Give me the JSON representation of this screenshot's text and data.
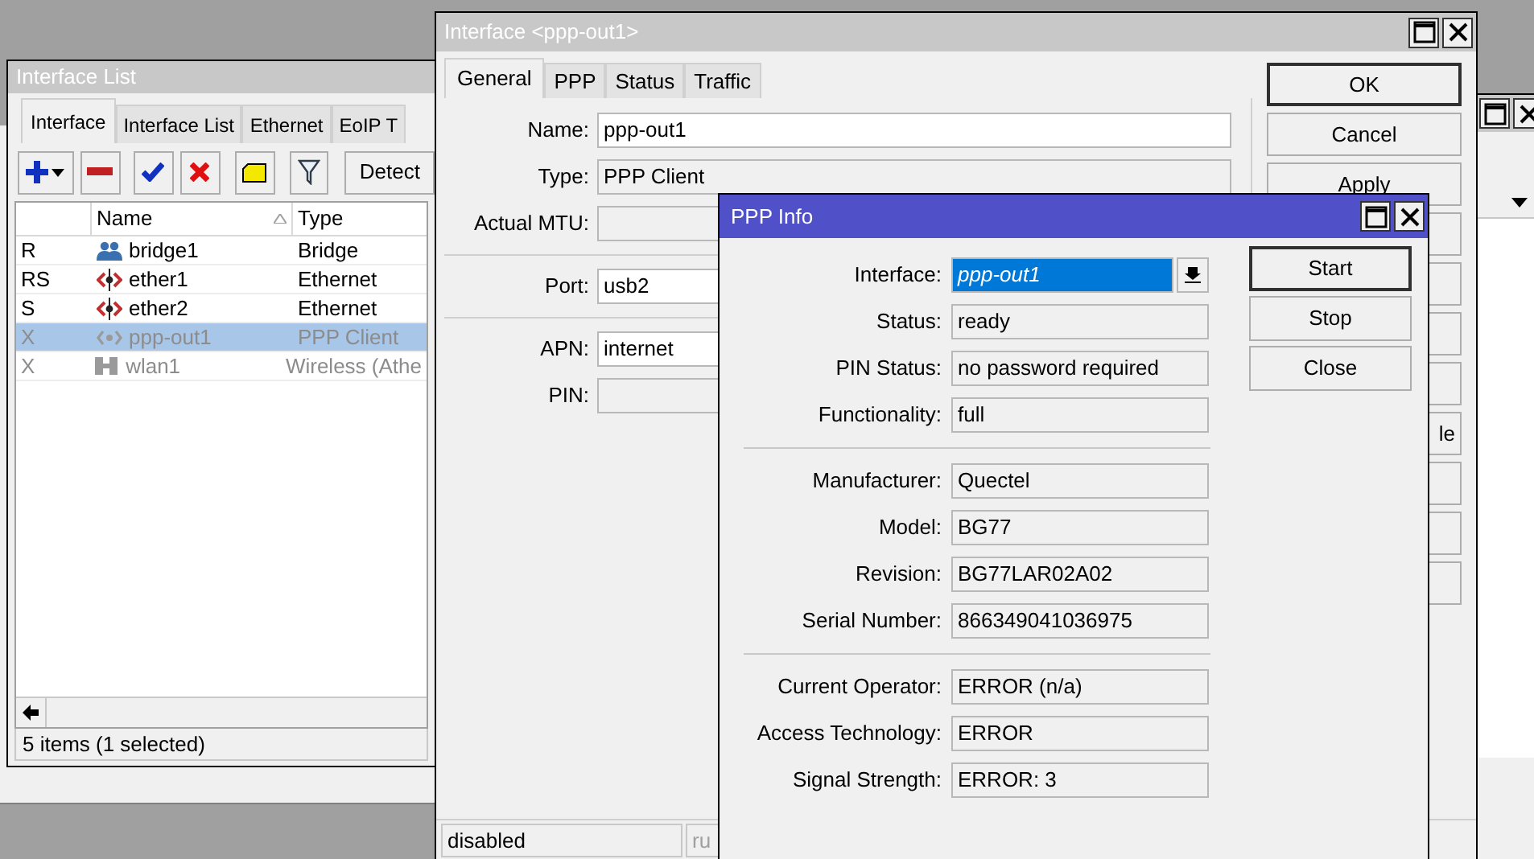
{
  "interface_list": {
    "title": "Interface List",
    "tabs": [
      {
        "label": "Interface",
        "selected": true
      },
      {
        "label": "Interface List",
        "selected": false
      },
      {
        "label": "Ethernet",
        "selected": false
      },
      {
        "label": "EoIP T",
        "selected": false
      }
    ],
    "detect_button": "Detect",
    "columns": [
      "Name",
      "Type"
    ],
    "rows": [
      {
        "flags": "R",
        "name": "bridge1",
        "type": "Bridge",
        "kind": "bridge",
        "disabled": false,
        "selected": false
      },
      {
        "flags": "RS",
        "name": "ether1",
        "type": "Ethernet",
        "kind": "ethernet",
        "disabled": false,
        "selected": false
      },
      {
        "flags": "S",
        "name": "ether2",
        "type": "Ethernet",
        "kind": "ethernet",
        "disabled": false,
        "selected": false
      },
      {
        "flags": "X",
        "name": "ppp-out1",
        "type": "PPP Client",
        "kind": "ppp",
        "disabled": true,
        "selected": true
      },
      {
        "flags": "X",
        "name": "wlan1",
        "type": "Wireless (Athe",
        "kind": "wireless",
        "disabled": true,
        "selected": false
      }
    ],
    "status": "5 items (1 selected)"
  },
  "interface_window": {
    "title": "Interface <ppp-out1>",
    "tabs": [
      {
        "label": "General",
        "selected": true
      },
      {
        "label": "PPP",
        "selected": false
      },
      {
        "label": "Status",
        "selected": false
      },
      {
        "label": "Traffic",
        "selected": false
      }
    ],
    "sections": [
      [
        {
          "label": "Name:",
          "value": "ppp-out1",
          "editable": true
        },
        {
          "label": "Type:",
          "value": "PPP Client",
          "editable": false
        },
        {
          "label": "Actual MTU:",
          "editable": false
        }
      ],
      [
        {
          "label": "Port:",
          "value": "usb2",
          "editable": true
        }
      ],
      [
        {
          "label": "APN:",
          "value": "internet",
          "editable": true
        },
        {
          "label": "PIN:",
          "editable": false
        }
      ]
    ],
    "buttons": [
      {
        "label": "OK",
        "default": true
      },
      {
        "label": "Cancel",
        "default": false
      },
      {
        "label": "Apply",
        "default": false
      }
    ],
    "partial_button": "le",
    "status_fields": [
      {
        "text": "disabled",
        "dimmed": false
      },
      {
        "text": "ru",
        "dimmed": true
      }
    ]
  },
  "ppp_info": {
    "title": "PPP Info",
    "sections": [
      [
        {
          "label": "Interface:",
          "value": "ppp-out1",
          "kind": "dropdown"
        },
        {
          "label": "Status:",
          "value": "ready",
          "kind": "readonly"
        },
        {
          "label": "PIN Status:",
          "value": "no password required",
          "kind": "readonly"
        },
        {
          "label": "Functionality:",
          "value": "full",
          "kind": "readonly"
        }
      ],
      [
        {
          "label": "Manufacturer:",
          "value": "Quectel",
          "kind": "readonly"
        },
        {
          "label": "Model:",
          "value": "BG77",
          "kind": "readonly"
        },
        {
          "label": "Revision:",
          "value": "BG77LAR02A02",
          "kind": "readonly"
        },
        {
          "label": "Serial Number:",
          "value": "866349041036975",
          "kind": "readonly"
        }
      ],
      [
        {
          "label": "Current Operator:",
          "value": "ERROR (n/a)",
          "kind": "readonly"
        },
        {
          "label": "Access Technology:",
          "value": "ERROR",
          "kind": "readonly"
        },
        {
          "label": "Signal Strength:",
          "value": "ERROR: 3",
          "kind": "readonly"
        }
      ]
    ],
    "buttons": [
      {
        "label": "Start",
        "default": true
      },
      {
        "label": "Stop",
        "default": false
      },
      {
        "label": "Close",
        "default": false
      }
    ]
  }
}
